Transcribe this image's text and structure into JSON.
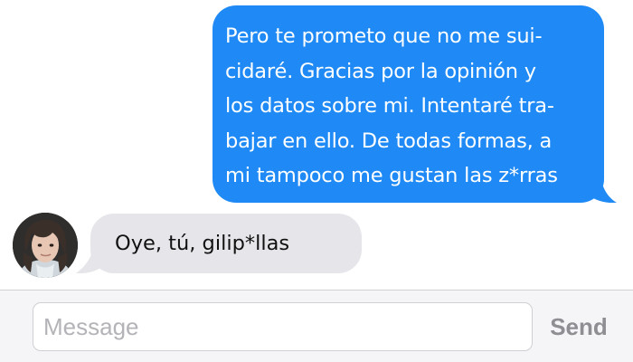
{
  "conversation": {
    "messages": [
      {
        "direction": "outgoing",
        "lines": [
          "Pero te prometo que no me sui-",
          "cidaré. Gracias por la opinión y",
          "los datos sobre mi. Intentaré tra-",
          "bajar en ello. De todas formas, a",
          "mi tampoco me gustan las z*rras"
        ]
      },
      {
        "direction": "incoming",
        "text": "Oye, tú, gilip*llas"
      }
    ]
  },
  "composer": {
    "placeholder": "Message",
    "value": "",
    "send_label": "Send"
  },
  "colors": {
    "outgoing_bubble": "#1f8af5",
    "incoming_bubble": "#e6e5ea",
    "send_disabled": "#8e8e93",
    "composer_background": "#f5f5f7"
  },
  "icons": {
    "contact": "avatar"
  }
}
